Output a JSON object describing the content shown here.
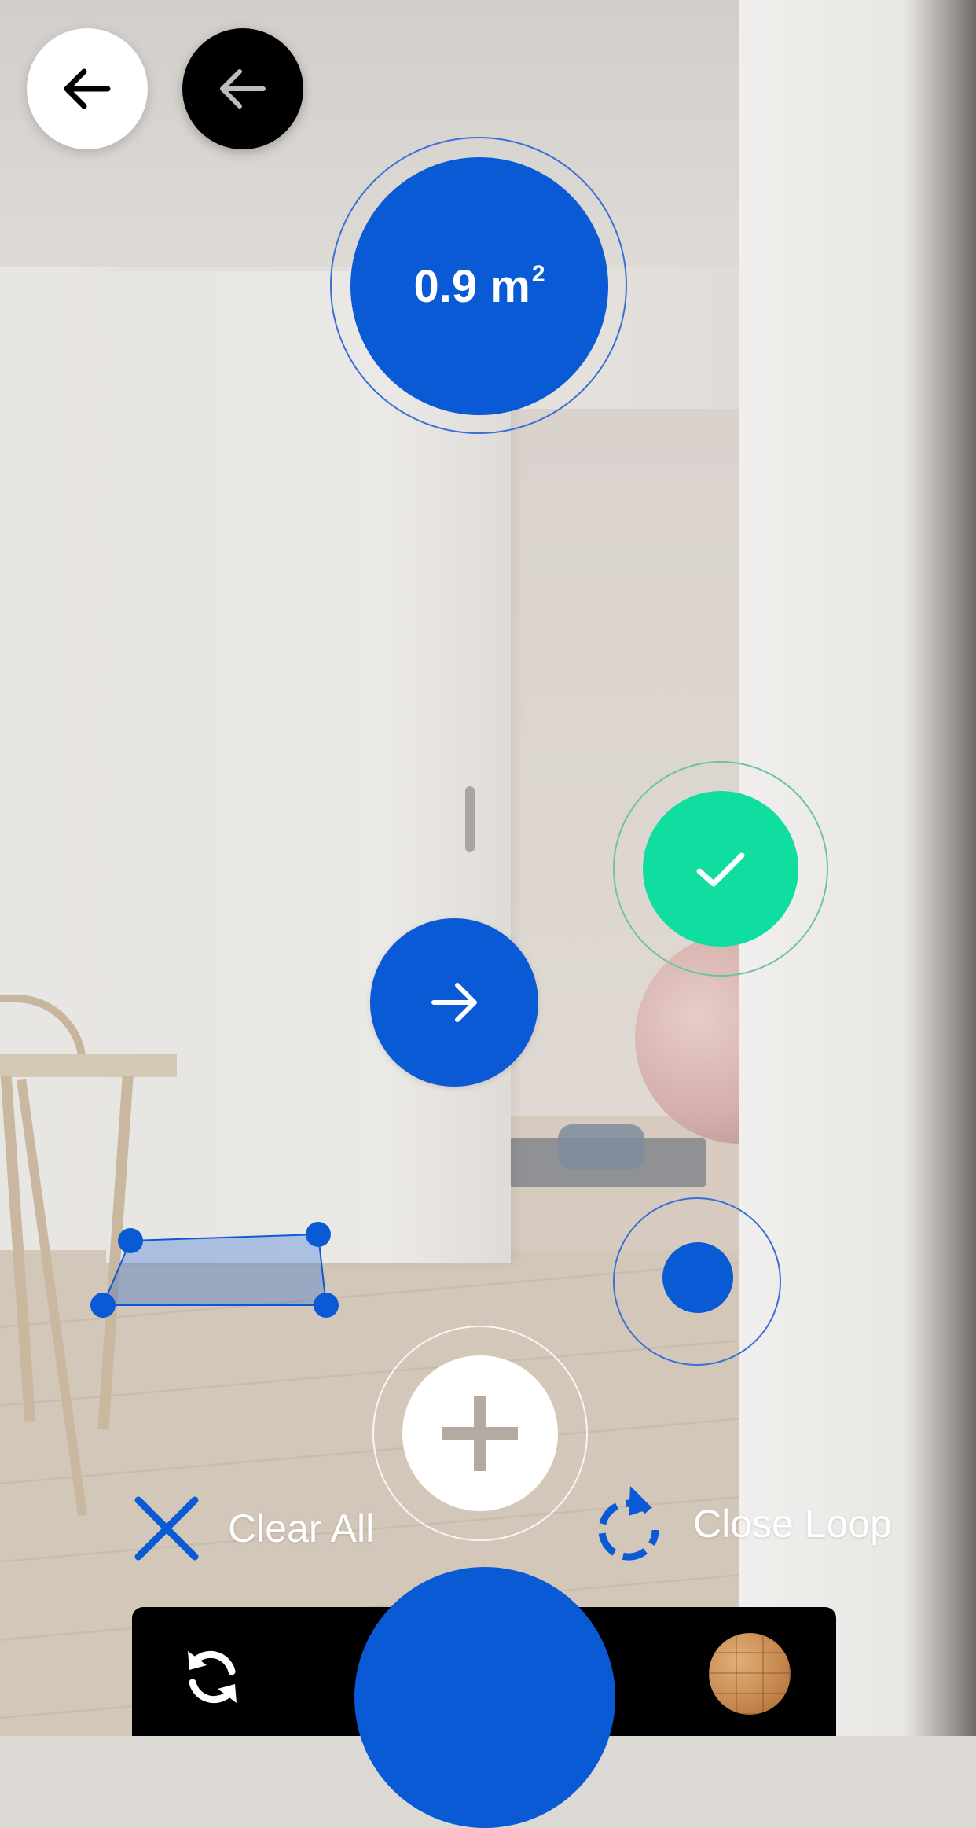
{
  "measurement": {
    "area_value": "0.9",
    "area_unit": "m",
    "area_exponent": "2"
  },
  "actions": {
    "clear_all_label": "Clear All",
    "close_loop_label": "Close Loop"
  },
  "icons": {
    "back": "arrow-left-icon",
    "undo": "arrow-left-icon",
    "confirm": "checkmark-icon",
    "next": "arrow-right-icon",
    "add": "plus-icon",
    "clear": "x-icon",
    "close_loop": "rotate-clockwise-icon",
    "switch_camera": "refresh-icon"
  },
  "colors": {
    "primary": "#0a5ad6",
    "confirm": "#10dea1",
    "toolbar": "#000000",
    "light": "#ffffff"
  }
}
